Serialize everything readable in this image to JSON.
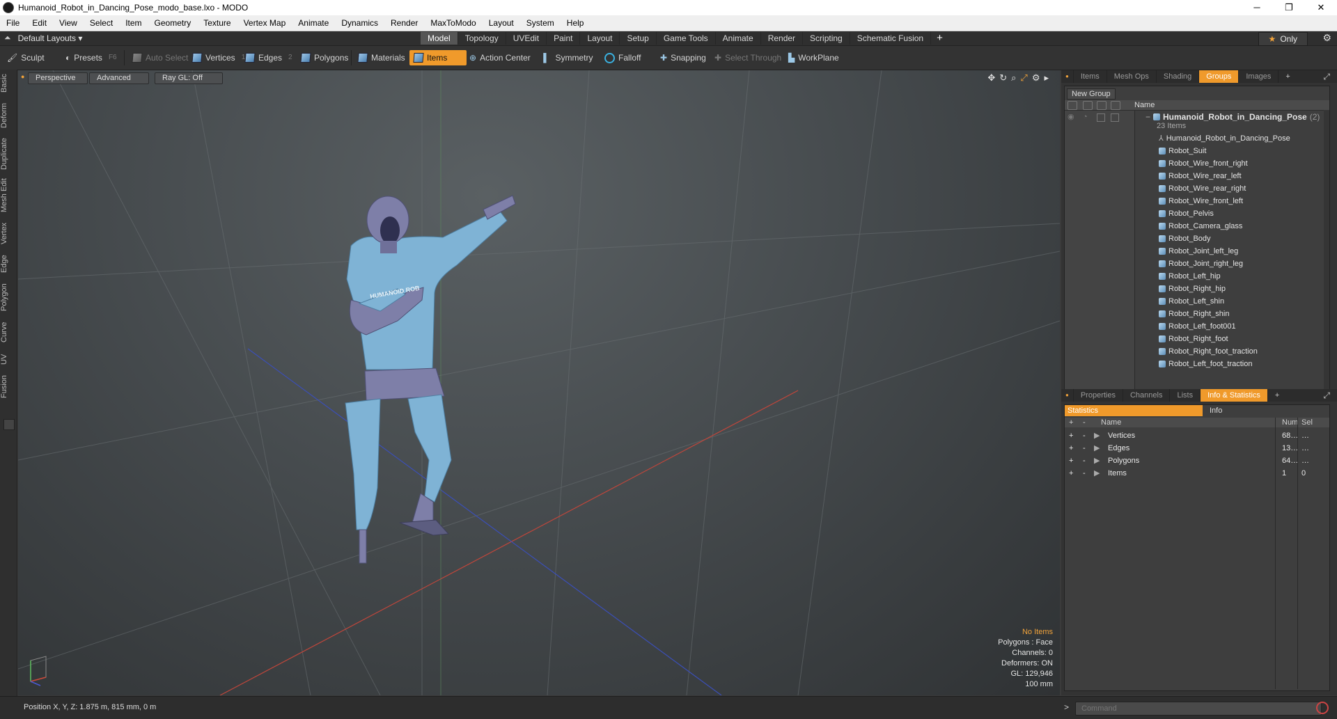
{
  "window": {
    "title": "Humanoid_Robot_in_Dancing_Pose_modo_base.lxo - MODO",
    "min": "─",
    "max": "❐",
    "close": "✕"
  },
  "menu": [
    "File",
    "Edit",
    "View",
    "Select",
    "Item",
    "Geometry",
    "Texture",
    "Vertex Map",
    "Animate",
    "Dynamics",
    "Render",
    "MaxToModo",
    "Layout",
    "System",
    "Help"
  ],
  "layout": {
    "name": "Default Layouts ▾",
    "only": "Only",
    "tabs": [
      "Model",
      "Topology",
      "UVEdit",
      "Paint",
      "Layout",
      "Setup",
      "Game Tools",
      "Animate",
      "Render",
      "Scripting",
      "Schematic Fusion"
    ],
    "plus": "+"
  },
  "toolbar": {
    "sculpt": "Sculpt",
    "presets": "Presets",
    "presets_key": "F6",
    "auto_select": "Auto Select",
    "vertices": "Vertices",
    "vertices_num": "1",
    "edges": "Edges",
    "edges_num": "2",
    "polygons": "Polygons",
    "materials": "Materials",
    "items": "Items",
    "action_center": "Action Center",
    "symmetry": "Symmetry",
    "falloff": "Falloff",
    "snapping": "Snapping",
    "select_through": "Select Through",
    "workplane": "WorkPlane"
  },
  "left_tabs": [
    "Basic",
    "Deform",
    "Duplicate",
    "Mesh Edit",
    "Vertex",
    "Edge",
    "Polygon",
    "Curve",
    "UV",
    "Fusion"
  ],
  "viewport": {
    "perspective": "Perspective",
    "advanced": "Advanced",
    "raygl": "Ray GL: Off",
    "shirt_text": "HUMANOID ROB",
    "info": {
      "no_items": "No Items",
      "polygons": "Polygons : Face",
      "channels": "Channels: 0",
      "deformers": "Deformers: ON",
      "gl": "GL: 129,946",
      "scale": "100 mm"
    }
  },
  "groups_panel": {
    "tabs": [
      "Items",
      "Mesh Ops",
      "Shading",
      "Groups",
      "Images"
    ],
    "active": "Groups",
    "plus": "+",
    "new_group": "New Group",
    "col_name": "Name",
    "root": {
      "name": "Humanoid_Robot_in_Dancing_Pose",
      "count": "(2)",
      "sub": "23 Items"
    },
    "items": [
      "Humanoid_Robot_in_Dancing_Pose",
      "Robot_Suit",
      "Robot_Wire_front_right",
      "Robot_Wire_rear_left",
      "Robot_Wire_rear_right",
      "Robot_Wire_front_left",
      "Robot_Pelvis",
      "Robot_Camera_glass",
      "Robot_Body",
      "Robot_Joint_left_leg",
      "Robot_Joint_right_leg",
      "Robot_Left_hip",
      "Robot_Right_hip",
      "Robot_Left_shin",
      "Robot_Right_shin",
      "Robot_Left_foot001",
      "Robot_Right_foot",
      "Robot_Right_foot_traction",
      "Robot_Left_foot_traction"
    ]
  },
  "stats_panel": {
    "tabs": [
      "Properties",
      "Channels",
      "Lists",
      "Info & Statistics"
    ],
    "active": "Info & Statistics",
    "plus": "+",
    "sub_tabs": [
      "Statistics",
      "Info"
    ],
    "head": {
      "plus": "+",
      "minus": "-",
      "name": "Name",
      "num": "Num",
      "sel": "Sel"
    },
    "rows": [
      {
        "name": "Vertices",
        "num": "68…",
        "sel": "…"
      },
      {
        "name": "Edges",
        "num": "13…",
        "sel": "…"
      },
      {
        "name": "Polygons",
        "num": "64…",
        "sel": "…"
      },
      {
        "name": "Items",
        "num": "1",
        "sel": "0"
      }
    ]
  },
  "status": {
    "position": "Position X, Y, Z:   1.875 m, 815 mm, 0 m",
    "command_placeholder": "Command",
    "gt": ">"
  },
  "colors": {
    "accent": "#f09a2b",
    "suit": "#7fb3d5",
    "joint": "#7e7fa8"
  }
}
